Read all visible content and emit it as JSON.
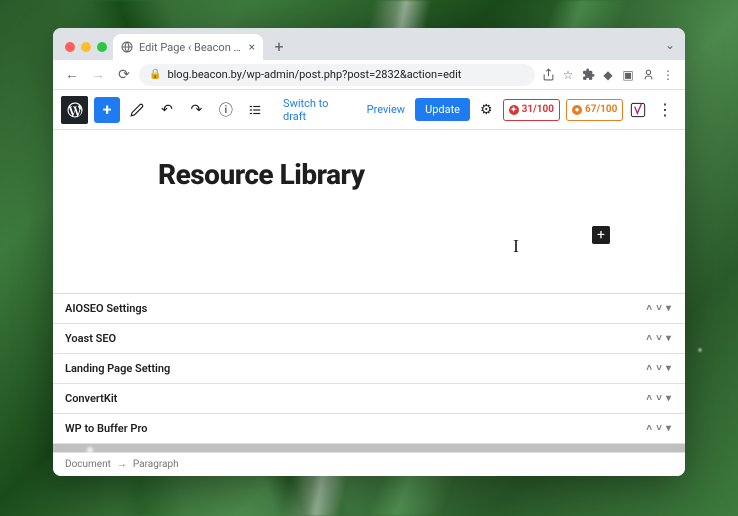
{
  "browser": {
    "tab_title": "Edit Page ‹ Beacon — WordPr",
    "url": "blog.beacon.by/wp-admin/post.php?post=2832&action=edit"
  },
  "toolbar": {
    "switch_draft": "Switch to draft",
    "preview": "Preview",
    "update": "Update",
    "seo_score_1": "31/100",
    "seo_score_2": "67/100"
  },
  "editor": {
    "page_title": "Resource Library"
  },
  "metaboxes": [
    {
      "label": "AIOSEO Settings"
    },
    {
      "label": "Yoast SEO"
    },
    {
      "label": "Landing Page Setting"
    },
    {
      "label": "ConvertKit"
    },
    {
      "label": "WP to Buffer Pro"
    }
  ],
  "breadcrumb": {
    "root": "Document",
    "current": "Paragraph"
  }
}
